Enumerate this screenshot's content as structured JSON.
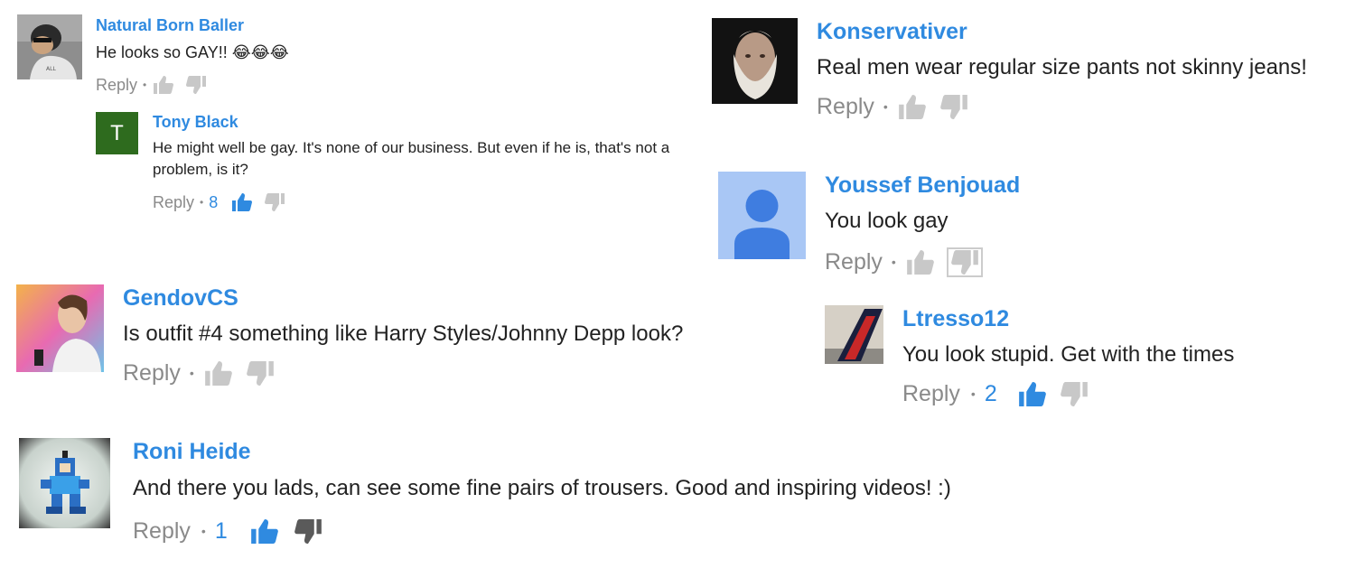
{
  "comments": [
    {
      "author": "Natural Born Baller",
      "text": "He looks so GAY!! 😂😂😂",
      "reply_label": "Reply",
      "separator": "•",
      "likes": "",
      "liked": false,
      "avatar": "child-photo-avatar"
    },
    {
      "author": "Tony Black",
      "text_line1": "He might well be gay. It's none of our business. But even if he is, that's not a",
      "text_line2": "problem, is it?",
      "reply_label": "Reply",
      "separator": "•",
      "likes": "8",
      "liked": true,
      "avatar_letter": "T",
      "avatar_color": "#2e6b1e"
    },
    {
      "author": "Konservativer",
      "text": "Real men wear regular size pants not skinny jeans!",
      "reply_label": "Reply",
      "separator": "•",
      "likes": "",
      "liked": false,
      "avatar": "old-man-photo-avatar"
    },
    {
      "author": "Youssef Benjouad",
      "text": "You look gay",
      "reply_label": "Reply",
      "separator": "•",
      "likes": "",
      "liked": false,
      "disliked": true,
      "avatar": "default-person-avatar"
    },
    {
      "author": "GendovCS",
      "text": "Is outfit #4 something like Harry Styles/Johnny Depp look?",
      "reply_label": "Reply",
      "separator": "•",
      "likes": "",
      "liked": false,
      "avatar": "woman-photo-avatar"
    },
    {
      "author": "Ltresso12",
      "text": "You look stupid. Get with the times",
      "reply_label": "Reply",
      "separator": "•",
      "likes": "2",
      "liked": true,
      "avatar": "airplane-tail-avatar"
    },
    {
      "author": "Roni Heide",
      "text": "And there you lads, can see some fine pairs of trousers. Good and inspiring videos! :)",
      "reply_label": "Reply",
      "separator": "•",
      "likes": "1",
      "liked": true,
      "avatar": "pixel-robot-avatar"
    }
  ],
  "colors": {
    "author_blue": "#2f8ae0",
    "text": "#222222",
    "muted": "#8a8a8a",
    "thumb_gray": "#c8c8c8"
  },
  "icons": [
    "thumbs-up-icon",
    "thumbs-down-icon"
  ]
}
